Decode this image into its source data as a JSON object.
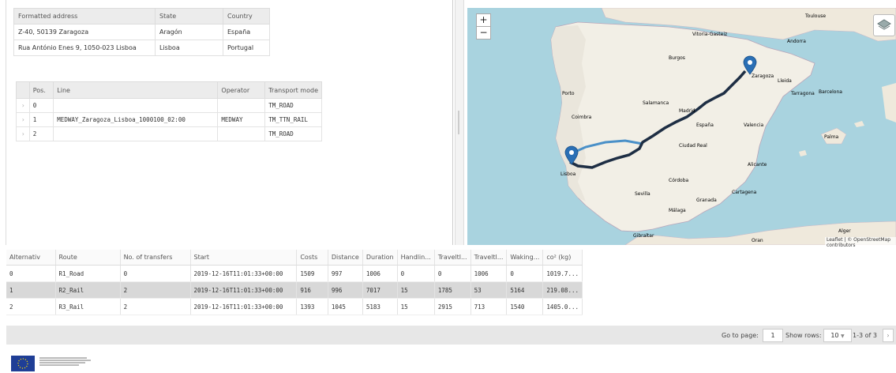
{
  "addresses": {
    "headers": [
      "Formatted address",
      "State",
      "Country"
    ],
    "rows": [
      [
        "Z-40, 50139 Zaragoza",
        "Aragón",
        "España"
      ],
      [
        "Rua António Enes 9, 1050-023 Lisboa",
        "Lisboa",
        "Portugal"
      ]
    ]
  },
  "route_legs": {
    "headers": [
      "Pos.",
      "Line",
      "Operator",
      "Transport mode"
    ],
    "rows": [
      [
        "0",
        "",
        "",
        "TM_ROAD"
      ],
      [
        "1",
        "MEDWAY_Zaragoza_Lisboa_1000100_02:00",
        "MEDWAY",
        "TM_TTN_RAIL"
      ],
      [
        "2",
        "",
        "",
        "TM_ROAD"
      ]
    ],
    "expand_icon": "chevron-right-icon"
  },
  "map": {
    "zoom_in": "+",
    "zoom_out": "−",
    "attribution": "Leaflet | © OpenStreetMap contributors",
    "labels": [
      "Toulouse",
      "Vitoria-Gasteiz",
      "Andorra",
      "Porto",
      "Zaragoza",
      "Lleida",
      "Barcelona",
      "Salamanca",
      "Madrid",
      "Tarragona",
      "Lisboa",
      "España",
      "Ciudad Real",
      "Valencia",
      "Palma",
      "Sevilla",
      "Málaga",
      "Alicante",
      "Córdoba",
      "Granada",
      "Cartagena",
      "Gibraltar",
      "Alger",
      "Coimbra",
      "Burgos",
      "Oran"
    ],
    "route_color_rail": "#1e2e44",
    "route_color_road": "#4a90c8",
    "marker_color": "#2a6fb5",
    "layers_icon": "layers-icon"
  },
  "results": {
    "headers": [
      "Alternativ",
      "Route",
      "No. of transfers",
      "Start",
      "Costs",
      "Distance",
      "Duration",
      "Handlin...",
      "Traveltl...",
      "Traveltl...",
      "Waking...",
      "co² (kg)"
    ],
    "rows": [
      [
        "0",
        "R1_Road",
        "0",
        "2019-12-16T11:01:33+00:00",
        "1509",
        "997",
        "1006",
        "0",
        "0",
        "1006",
        "0",
        "1019.7..."
      ],
      [
        "1",
        "R2_Rail",
        "2",
        "2019-12-16T11:01:33+00:00",
        "916",
        "996",
        "7017",
        "15",
        "1785",
        "53",
        "5164",
        "219.08..."
      ],
      [
        "2",
        "R3_Rail",
        "2",
        "2019-12-16T11:01:33+00:00",
        "1393",
        "1045",
        "5183",
        "15",
        "2915",
        "713",
        "1540",
        "1405.0..."
      ]
    ],
    "selected_row": 1
  },
  "pager": {
    "goto_label": "Go to page:",
    "page": "1",
    "show_rows_label": "Show rows:",
    "rows_value": "10",
    "range": "1-3 of 3"
  }
}
